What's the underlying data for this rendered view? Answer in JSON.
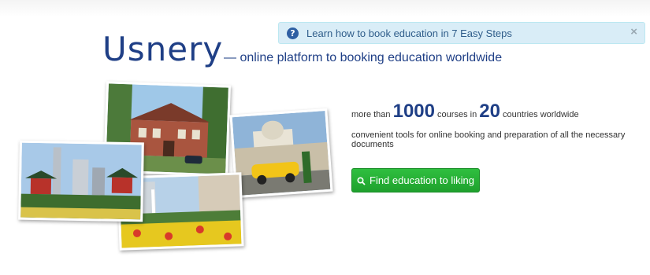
{
  "alert": {
    "icon": "question-circle-icon",
    "text": "Learn how to book education in 7 Easy Steps",
    "close": "×"
  },
  "hero": {
    "logo": "Usnery",
    "tagline": "— online platform to booking education worldwide"
  },
  "stats": {
    "prefix": "more than",
    "courses_count": "1000",
    "courses_label": "courses in",
    "countries_count": "20",
    "countries_label": "countries worldwide"
  },
  "description": "convenient tools for online booking and preparation of all the necessary documents",
  "cta": {
    "icon": "search-icon",
    "label": "Find education to liking"
  },
  "colors": {
    "brand": "#1f3f86",
    "alert_bg": "#d9edf7",
    "button": "#22a833"
  }
}
